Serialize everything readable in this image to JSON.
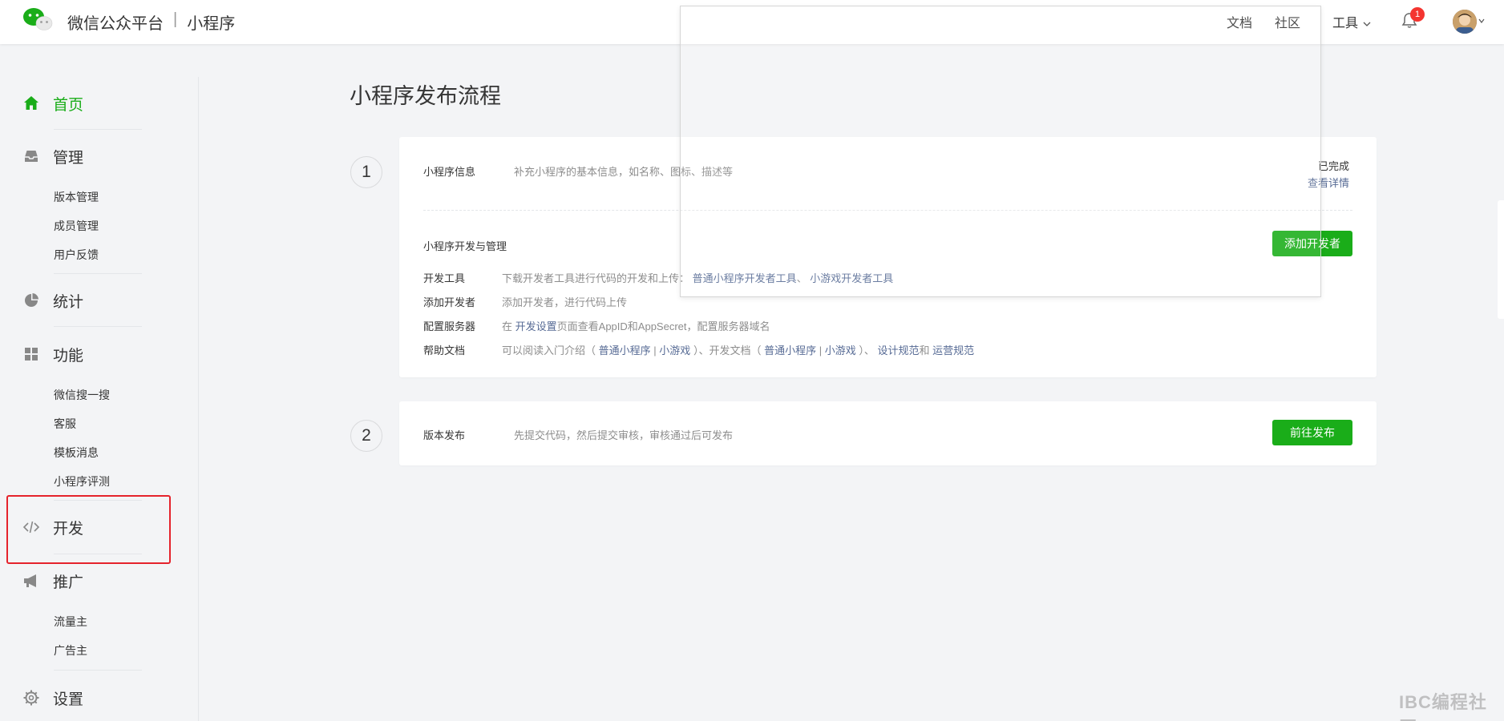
{
  "header": {
    "platform": "微信公众平台",
    "separator": "|",
    "product": "小程序",
    "nav": {
      "docs": "文档",
      "community": "社区",
      "tools": "工具"
    },
    "notification_count": "1"
  },
  "sidebar": {
    "home": "首页",
    "manage": {
      "label": "管理",
      "items": [
        "版本管理",
        "成员管理",
        "用户反馈"
      ]
    },
    "stats": "统计",
    "features": {
      "label": "功能",
      "items": [
        "微信搜一搜",
        "客服",
        "模板消息",
        "小程序评测"
      ]
    },
    "develop": "开发",
    "promote": {
      "label": "推广",
      "items": [
        "流量主",
        "广告主"
      ]
    },
    "settings": "设置"
  },
  "main": {
    "title": "小程序发布流程",
    "step1": {
      "number": "1",
      "info_label": "小程序信息",
      "info_desc": "补充小程序的基本信息，如名称、图标、描述等",
      "status": "已完成",
      "view_detail": "查看详情",
      "dev_title": "小程序开发与管理",
      "add_dev_button": "添加开发者",
      "rows": {
        "tools": {
          "label": "开发工具",
          "text": "下载开发者工具进行代码的开发和上传：",
          "link1": "普通小程序开发者工具",
          "sep": "、",
          "link2": "小游戏开发者工具"
        },
        "add_dev": {
          "label": "添加开发者",
          "text": "添加开发者，进行代码上传"
        },
        "server": {
          "label": "配置服务器",
          "prefix": "在",
          "link": "开发设置",
          "suffix": "页面查看AppID和AppSecret，配置服务器域名"
        },
        "help": {
          "label": "帮助文档",
          "t1": "可以阅读入门介绍（",
          "l1": "普通小程序",
          "bar": "|",
          "l2": "小游戏",
          "t2": "）、开发文档（",
          "l3": "普通小程序",
          "l4": "小游戏",
          "t3": "）、",
          "l5": "设计规范",
          "t4": "和",
          "l6": "运营规范"
        }
      }
    },
    "step2": {
      "number": "2",
      "label": "版本发布",
      "desc": "先提交代码，然后提交审核，审核通过后可发布",
      "button": "前往发布"
    }
  },
  "watermark": "IBC编程社区",
  "colors": {
    "brand_green": "#1aad19",
    "link_blue": "#576b95",
    "highlight_red": "#e5232c",
    "badge_red": "#f43530"
  }
}
